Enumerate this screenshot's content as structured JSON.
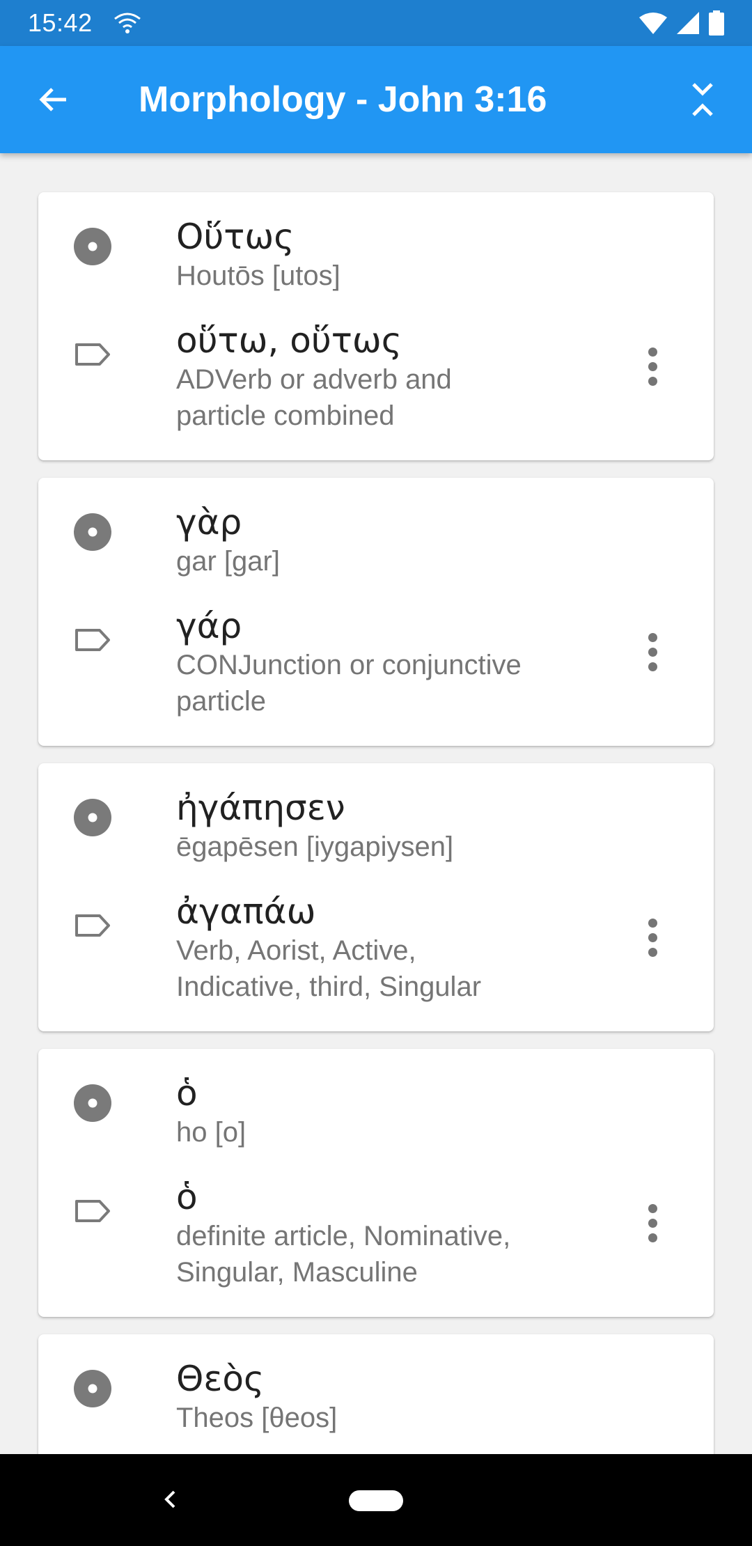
{
  "status_bar": {
    "time": "15:42"
  },
  "app_bar": {
    "title": "Morphology - John 3:16"
  },
  "words": [
    {
      "word": "Οὕτως",
      "transliteration": "Houtōs [utos]",
      "lemma": "οὕτω, οὕτως",
      "parsing_line1": "ADVerb or adverb and",
      "parsing_line2": "particle combined"
    },
    {
      "word": "γὰρ",
      "transliteration": "gar [gar]",
      "lemma": "γάρ",
      "parsing_line1": "CONJunction or conjunctive",
      "parsing_line2": "particle"
    },
    {
      "word": "ἠγάπησεν",
      "transliteration": "ēgapēsen [iygapiysen]",
      "lemma": "ἀγαπάω",
      "parsing_line1": "Verb, Aorist, Active,",
      "parsing_line2": "Indicative, third, Singular"
    },
    {
      "word": "ὁ",
      "transliteration": "ho [o]",
      "lemma": "ὁ",
      "parsing_line1": "definite article, Nominative,",
      "parsing_line2": "Singular, Masculine"
    },
    {
      "word": "Θεὸς",
      "transliteration": "Theos [θeos]"
    }
  ],
  "icons": {
    "word": "radio-target-icon",
    "lemma": "label-tag-icon",
    "more": "more-vert-icon",
    "back": "arrow-back-icon",
    "collapse": "collapse-all-icon"
  },
  "colors": {
    "status_bar": "#1e7fcf",
    "app_bar": "#2196f3",
    "background": "#f1f1f1",
    "primary_text": "#212121",
    "secondary_text": "#757575"
  }
}
